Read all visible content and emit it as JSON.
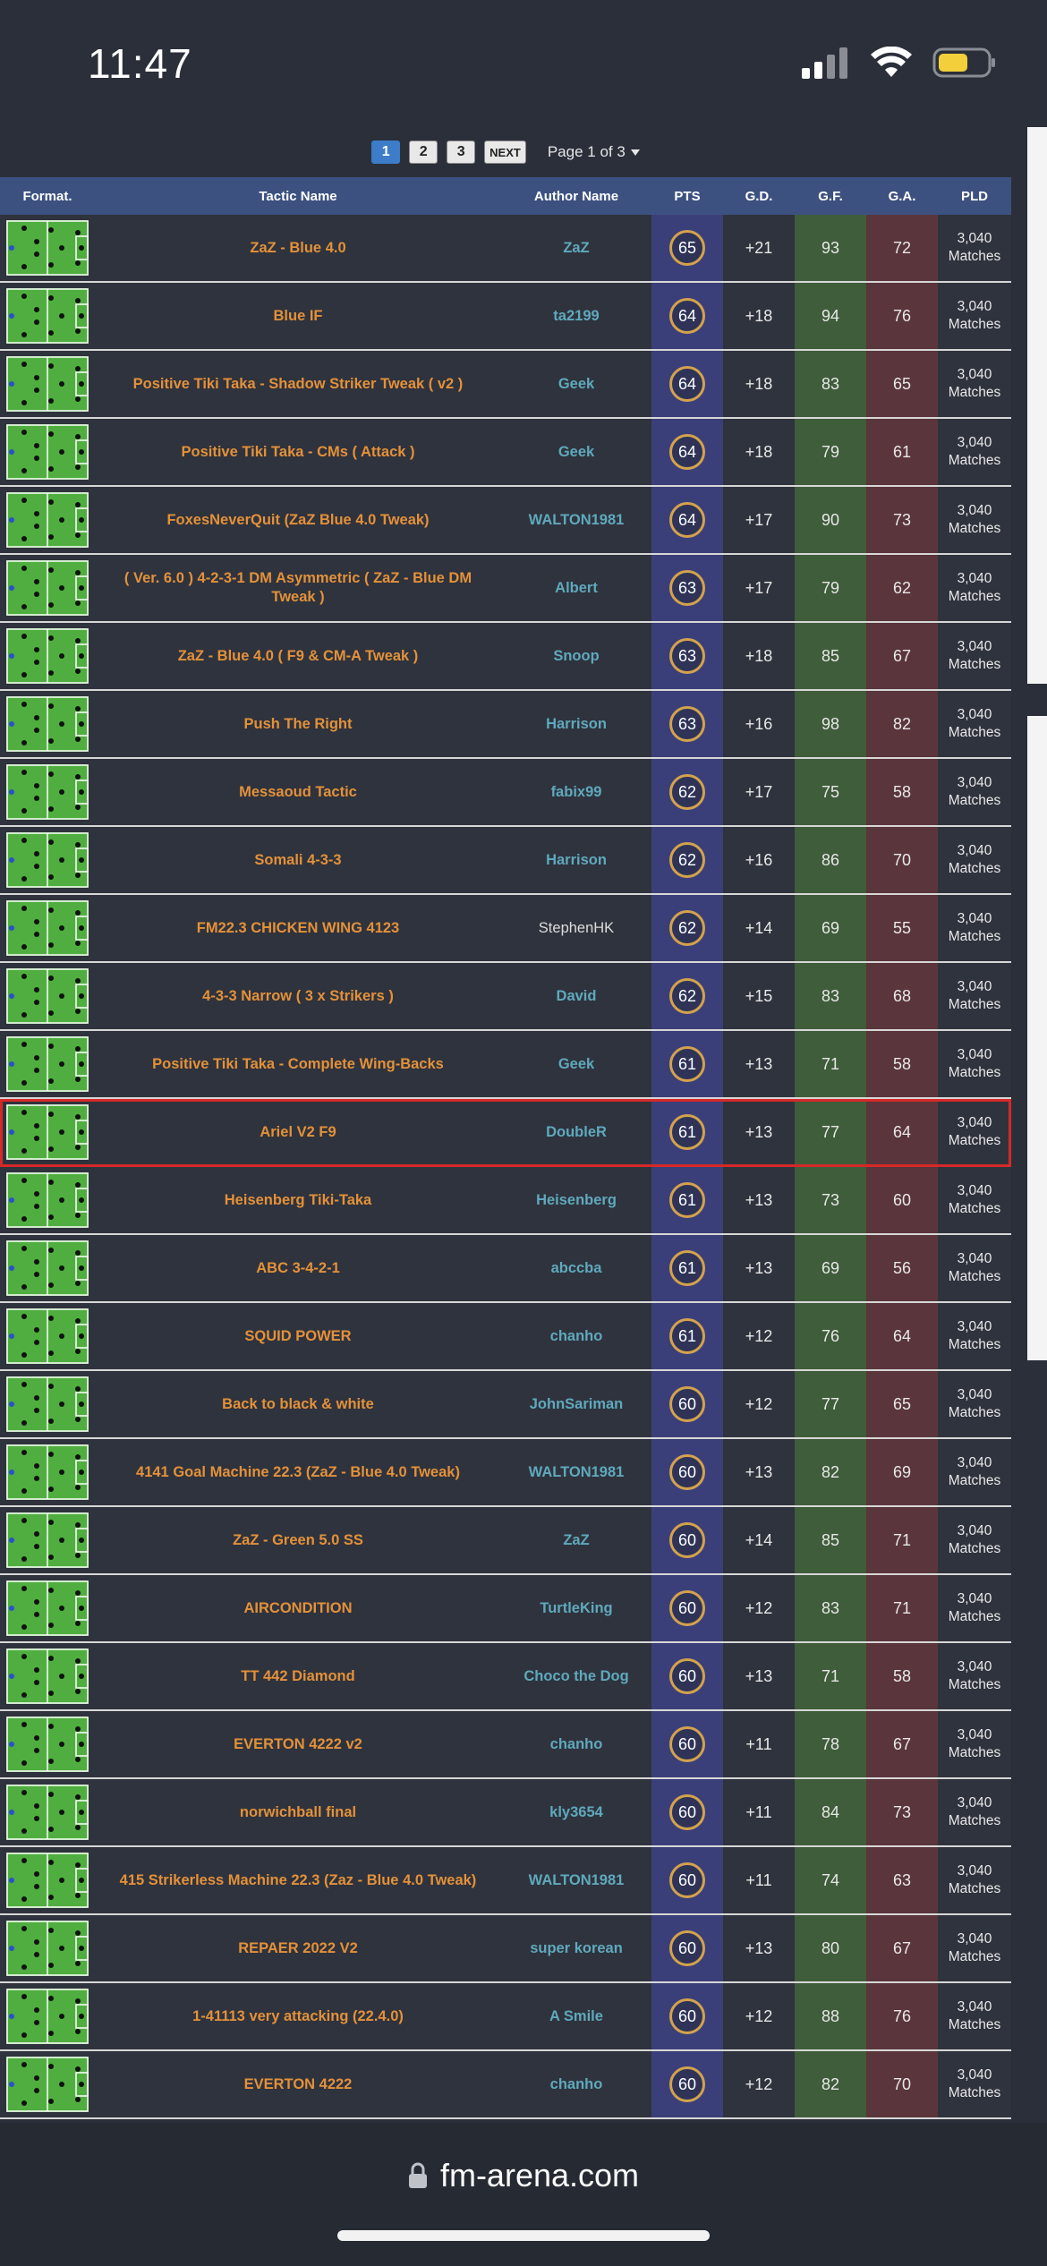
{
  "status_bar": {
    "time": "11:47"
  },
  "pagination": {
    "pages": [
      "1",
      "2",
      "3"
    ],
    "active": "1",
    "next_label": "NEXT",
    "page_info": "Page 1 of 3"
  },
  "columns": {
    "format": "Format.",
    "name": "Tactic Name",
    "author": "Author Name",
    "pts": "PTS",
    "gd": "G.D.",
    "gf": "G.F.",
    "ga": "G.A.",
    "pld": "PLD"
  },
  "rows": [
    {
      "name": "ZaZ - Blue 4.0",
      "author": "ZaZ",
      "pts": "65",
      "gd": "+21",
      "gf": "93",
      "ga": "72",
      "pld1": "3,040",
      "pld2": "Matches"
    },
    {
      "name": "Blue IF",
      "author": "ta2199",
      "pts": "64",
      "gd": "+18",
      "gf": "94",
      "ga": "76",
      "pld1": "3,040",
      "pld2": "Matches"
    },
    {
      "name": "Positive Tiki Taka - Shadow Striker Tweak ( v2 )",
      "author": "Geek",
      "pts": "64",
      "gd": "+18",
      "gf": "83",
      "ga": "65",
      "pld1": "3,040",
      "pld2": "Matches"
    },
    {
      "name": "Positive Tiki Taka - CMs ( Attack )",
      "author": "Geek",
      "pts": "64",
      "gd": "+18",
      "gf": "79",
      "ga": "61",
      "pld1": "3,040",
      "pld2": "Matches"
    },
    {
      "name": "FoxesNeverQuit (ZaZ Blue 4.0 Tweak)",
      "author": "WALTON1981",
      "pts": "64",
      "gd": "+17",
      "gf": "90",
      "ga": "73",
      "pld1": "3,040",
      "pld2": "Matches"
    },
    {
      "name": "( Ver. 6.0 ) 4-2-3-1 DM Asymmetric ( ZaZ - Blue DM Tweak )",
      "author": "Albert",
      "pts": "63",
      "gd": "+17",
      "gf": "79",
      "ga": "62",
      "pld1": "3,040",
      "pld2": "Matches"
    },
    {
      "name": "ZaZ - Blue 4.0 ( F9 & CM-A Tweak )",
      "author": "Snoop",
      "pts": "63",
      "gd": "+18",
      "gf": "85",
      "ga": "67",
      "pld1": "3,040",
      "pld2": "Matches"
    },
    {
      "name": "Push The Right",
      "author": "Harrison",
      "pts": "63",
      "gd": "+16",
      "gf": "98",
      "ga": "82",
      "pld1": "3,040",
      "pld2": "Matches"
    },
    {
      "name": "Messaoud Tactic",
      "author": "fabix99",
      "pts": "62",
      "gd": "+17",
      "gf": "75",
      "ga": "58",
      "pld1": "3,040",
      "pld2": "Matches"
    },
    {
      "name": "Somali 4-3-3",
      "author": "Harrison",
      "pts": "62",
      "gd": "+16",
      "gf": "86",
      "ga": "70",
      "pld1": "3,040",
      "pld2": "Matches"
    },
    {
      "name": "FM22.3 CHICKEN WING 4123",
      "author": "StephenHK",
      "pts": "62",
      "gd": "+14",
      "gf": "69",
      "ga": "55",
      "pld1": "3,040",
      "pld2": "Matches",
      "plain_author": true
    },
    {
      "name": "4-3-3 Narrow ( 3 x Strikers )",
      "author": "David",
      "pts": "62",
      "gd": "+15",
      "gf": "83",
      "ga": "68",
      "pld1": "3,040",
      "pld2": "Matches"
    },
    {
      "name": "Positive Tiki Taka - Complete Wing-Backs",
      "author": "Geek",
      "pts": "61",
      "gd": "+13",
      "gf": "71",
      "ga": "58",
      "pld1": "3,040",
      "pld2": "Matches"
    },
    {
      "name": "Ariel V2 F9",
      "author": "DoubleR",
      "pts": "61",
      "gd": "+13",
      "gf": "77",
      "ga": "64",
      "pld1": "3,040",
      "pld2": "Matches",
      "highlight": true
    },
    {
      "name": "Heisenberg Tiki-Taka",
      "author": "Heisenberg",
      "pts": "61",
      "gd": "+13",
      "gf": "73",
      "ga": "60",
      "pld1": "3,040",
      "pld2": "Matches"
    },
    {
      "name": "ABC 3-4-2-1",
      "author": "abccba",
      "pts": "61",
      "gd": "+13",
      "gf": "69",
      "ga": "56",
      "pld1": "3,040",
      "pld2": "Matches"
    },
    {
      "name": "SQUID POWER",
      "author": "chanho",
      "pts": "61",
      "gd": "+12",
      "gf": "76",
      "ga": "64",
      "pld1": "3,040",
      "pld2": "Matches"
    },
    {
      "name": "Back to black & white",
      "author": "JohnSariman",
      "pts": "60",
      "gd": "+12",
      "gf": "77",
      "ga": "65",
      "pld1": "3,040",
      "pld2": "Matches"
    },
    {
      "name": "4141 Goal Machine 22.3 (ZaZ - Blue 4.0 Tweak)",
      "author": "WALTON1981",
      "pts": "60",
      "gd": "+13",
      "gf": "82",
      "ga": "69",
      "pld1": "3,040",
      "pld2": "Matches"
    },
    {
      "name": "ZaZ - Green 5.0 SS",
      "author": "ZaZ",
      "pts": "60",
      "gd": "+14",
      "gf": "85",
      "ga": "71",
      "pld1": "3,040",
      "pld2": "Matches"
    },
    {
      "name": "AIRCONDITION",
      "author": "TurtleKing",
      "pts": "60",
      "gd": "+12",
      "gf": "83",
      "ga": "71",
      "pld1": "3,040",
      "pld2": "Matches"
    },
    {
      "name": "TT 442 Diamond",
      "author": "Choco the Dog",
      "pts": "60",
      "gd": "+13",
      "gf": "71",
      "ga": "58",
      "pld1": "3,040",
      "pld2": "Matches"
    },
    {
      "name": "EVERTON 4222 v2",
      "author": "chanho",
      "pts": "60",
      "gd": "+11",
      "gf": "78",
      "ga": "67",
      "pld1": "3,040",
      "pld2": "Matches"
    },
    {
      "name": "norwichball final",
      "author": "kly3654",
      "pts": "60",
      "gd": "+11",
      "gf": "84",
      "ga": "73",
      "pld1": "3,040",
      "pld2": "Matches"
    },
    {
      "name": "415 Strikerless Machine 22.3 (Zaz - Blue 4.0 Tweak)",
      "author": "WALTON1981",
      "pts": "60",
      "gd": "+11",
      "gf": "74",
      "ga": "63",
      "pld1": "3,040",
      "pld2": "Matches"
    },
    {
      "name": "REPAER 2022 V2",
      "author": "super korean",
      "pts": "60",
      "gd": "+13",
      "gf": "80",
      "ga": "67",
      "pld1": "3,040",
      "pld2": "Matches"
    },
    {
      "name": "1-41113 very attacking (22.4.0)",
      "author": "A Smile",
      "pts": "60",
      "gd": "+12",
      "gf": "88",
      "ga": "76",
      "pld1": "3,040",
      "pld2": "Matches"
    },
    {
      "name": "EVERTON 4222",
      "author": "chanho",
      "pts": "60",
      "gd": "+12",
      "gf": "82",
      "ga": "70",
      "pld1": "3,040",
      "pld2": "Matches"
    }
  ],
  "browser": {
    "url": "fm-arena.com"
  },
  "colors": {
    "header_bg": "#3c5180",
    "tactic_name": "#e3913a",
    "author": "#5fa9bd",
    "pts_col": "#3b3f79",
    "gf_col": "#3f5d3a",
    "ga_col": "#5a353b",
    "highlight": "#d62828"
  }
}
